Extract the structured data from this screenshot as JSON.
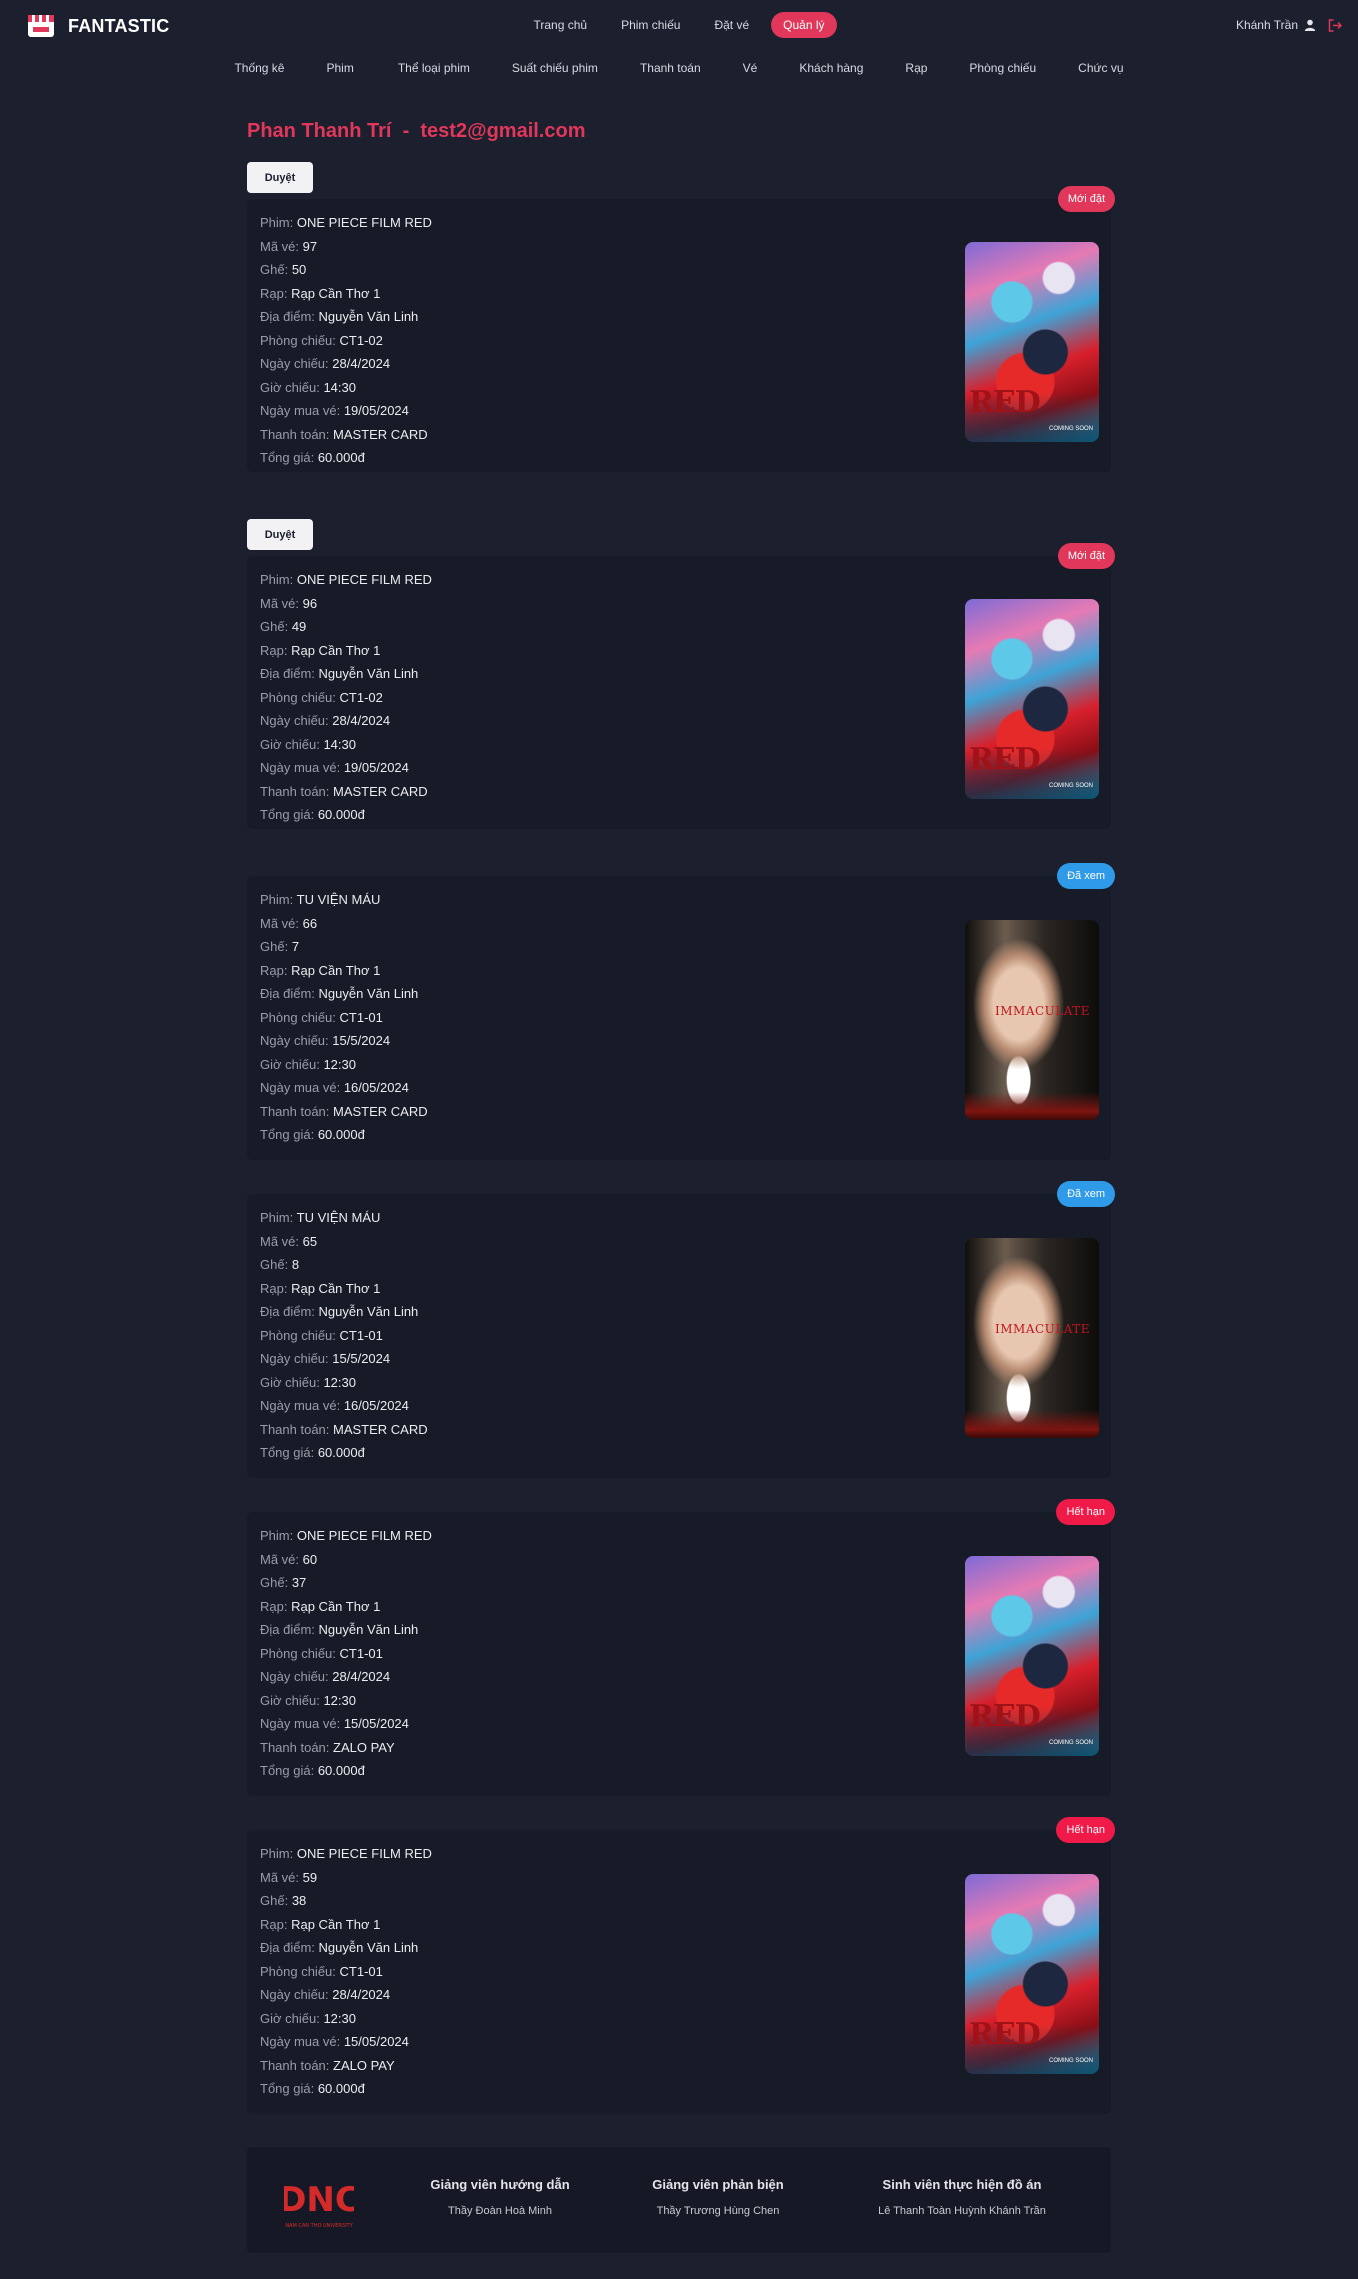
{
  "header": {
    "brand": "FANTASTIC",
    "nav": [
      "Trang chủ",
      "Phim chiếu",
      "Đặt vé",
      "Quản lý"
    ],
    "active_nav": "Quản lý",
    "user_name": "Khánh Trần"
  },
  "subnav": [
    "Thống kê",
    "Phim",
    "Thể loại phim",
    "Suất chiếu phim",
    "Thanh toán",
    "Vé",
    "Khách hàng",
    "Rạp",
    "Phòng chiếu",
    "Chức vụ"
  ],
  "page": {
    "customer_name": "Phan Thanh Trí",
    "separator": "-",
    "customer_email": "test2@gmail.com"
  },
  "labels": {
    "approve": "Duyệt",
    "movie": "Phim:",
    "ticket_id": "Mã vé:",
    "seat": "Ghế:",
    "cinema": "Rạp:",
    "location": "Địa điểm:",
    "room": "Phòng chiếu:",
    "show_date": "Ngày chiếu:",
    "show_time": "Giờ chiếu:",
    "purchase_date": "Ngày mua vé:",
    "payment": "Thanh toán:",
    "total": "Tổng giá:"
  },
  "tickets": [
    {
      "status": "Mới đặt",
      "movie": "ONE PIECE FILM RED",
      "ticket_id": "97",
      "seat": "50",
      "cinema": "Rạp Cần Thơ 1",
      "location": "Nguyễn Văn Linh",
      "room": "CT1-02",
      "show_date": "28/4/2024",
      "show_time": "14:30",
      "purchase_date": "19/05/2024",
      "payment": "MASTER CARD",
      "total": "60.000đ",
      "poster_title": "RED",
      "poster_caption": "COMING SOON"
    },
    {
      "status": "Mới đặt",
      "movie": "ONE PIECE FILM RED",
      "ticket_id": "96",
      "seat": "49",
      "cinema": "Rạp Cần Thơ 1",
      "location": "Nguyễn Văn Linh",
      "room": "CT1-02",
      "show_date": "28/4/2024",
      "show_time": "14:30",
      "purchase_date": "19/05/2024",
      "payment": "MASTER CARD",
      "total": "60.000đ",
      "poster_title": "RED",
      "poster_caption": "COMING SOON"
    },
    {
      "status": "Đã xem",
      "movie": "TU VIỆN MÁU",
      "ticket_id": "66",
      "seat": "7",
      "cinema": "Rạp Cần Thơ 1",
      "location": "Nguyễn Văn Linh",
      "room": "CT1-01",
      "show_date": "15/5/2024",
      "show_time": "12:30",
      "purchase_date": "16/05/2024",
      "payment": "MASTER CARD",
      "total": "60.000đ",
      "poster_title": "IMMACULATE"
    },
    {
      "status": "Đã xem",
      "movie": "TU VIỆN MÁU",
      "ticket_id": "65",
      "seat": "8",
      "cinema": "Rạp Cần Thơ 1",
      "location": "Nguyễn Văn Linh",
      "room": "CT1-01",
      "show_date": "15/5/2024",
      "show_time": "12:30",
      "purchase_date": "16/05/2024",
      "payment": "MASTER CARD",
      "total": "60.000đ",
      "poster_title": "IMMACULATE"
    },
    {
      "status": "Hết hạn",
      "movie": "ONE PIECE FILM RED",
      "ticket_id": "60",
      "seat": "37",
      "cinema": "Rạp Cần Thơ 1",
      "location": "Nguyễn Văn Linh",
      "room": "CT1-01",
      "show_date": "28/4/2024",
      "show_time": "12:30",
      "purchase_date": "15/05/2024",
      "payment": "ZALO PAY",
      "total": "60.000đ",
      "poster_title": "RED",
      "poster_caption": "COMING SOON"
    },
    {
      "status": "Hết hạn",
      "movie": "ONE PIECE FILM RED",
      "ticket_id": "59",
      "seat": "38",
      "cinema": "Rạp Cần Thơ 1",
      "location": "Nguyễn Văn Linh",
      "room": "CT1-01",
      "show_date": "28/4/2024",
      "show_time": "12:30",
      "purchase_date": "15/05/2024",
      "payment": "ZALO PAY",
      "total": "60.000đ",
      "poster_title": "RED",
      "poster_caption": "COMING SOON"
    }
  ],
  "footer": {
    "logo_text": "DNC",
    "logo_caption": "NAM CAN THO UNIVERSITY",
    "col1_title": "Giảng viên hướng dẫn",
    "col1_value": "Thầy Đoàn Hoà Minh",
    "col2_title": "Giảng viên phản biện",
    "col2_value": "Thầy Trương Hùng Chen",
    "col3_title": "Sinh viên thực hiện đồ án",
    "col3_value": "Lê Thanh Toàn Huỳnh Khánh Trần"
  },
  "colors": {
    "accent": "#e0375a",
    "status_new": "#e0375a",
    "status_seen": "#2f9be8",
    "status_expired": "#f01a48",
    "background": "#1c1f2e"
  }
}
